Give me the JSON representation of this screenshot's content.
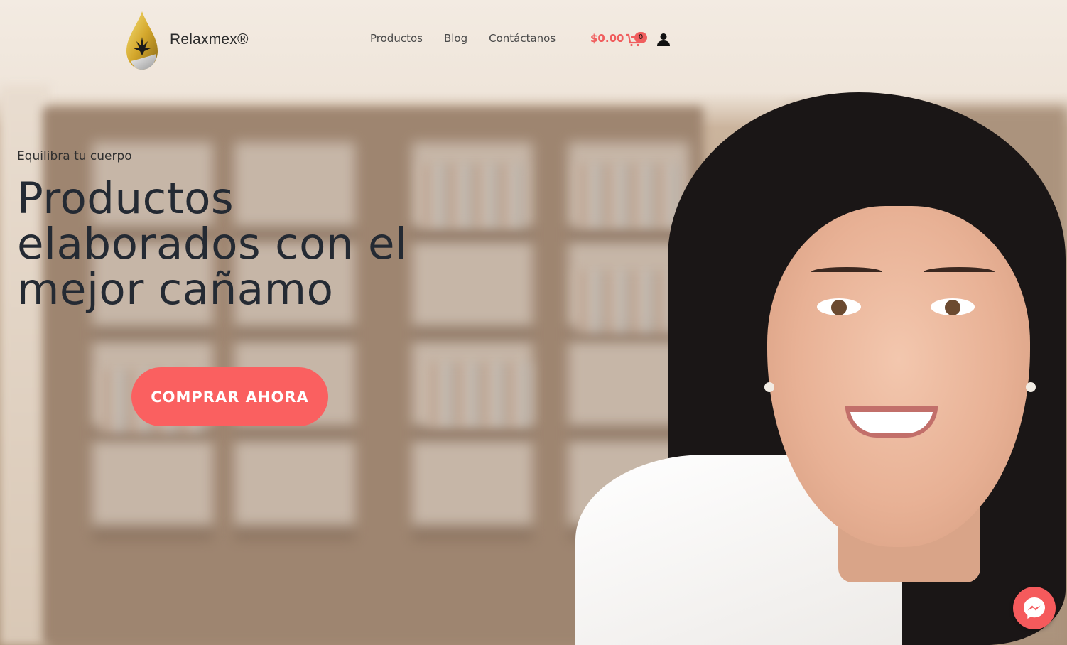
{
  "brand": {
    "name": "Relaxmex®",
    "logo_icon": "oil-drop-cannabis-leaf-icon"
  },
  "nav": {
    "items": [
      "Productos",
      "Blog",
      "Contáctanos"
    ]
  },
  "cart": {
    "price": "$0.00",
    "count": "0",
    "icon": "shopping-cart-icon"
  },
  "account": {
    "icon": "user-icon"
  },
  "hero": {
    "eyebrow": "Equilibra tu cuerpo",
    "headline": "Productos elaborados con el mejor cañamo",
    "cta_label": "COMPRAR AHORA"
  },
  "chat": {
    "icon": "messenger-icon"
  },
  "colors": {
    "accent": "#fa6060",
    "text_dark": "#242a33",
    "cart_price": "#f05e5e"
  }
}
